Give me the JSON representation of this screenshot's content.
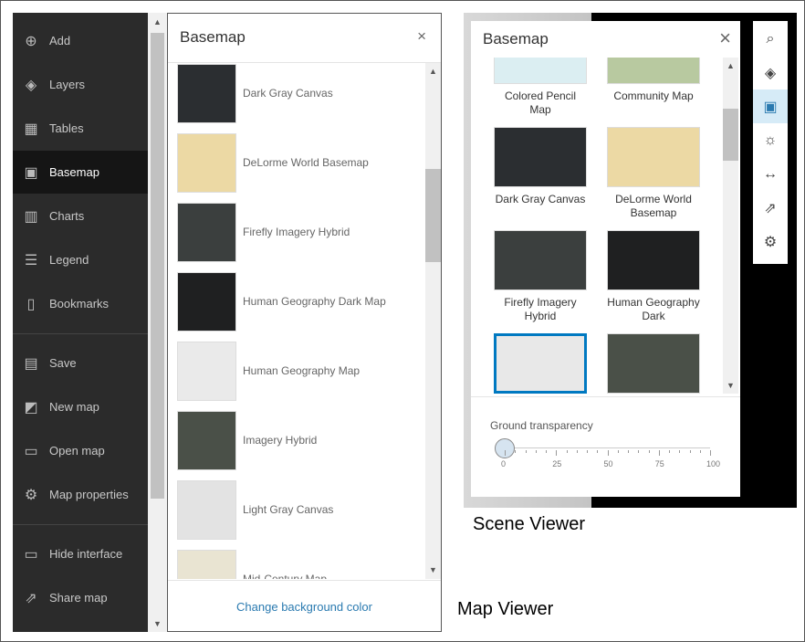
{
  "map_viewer": {
    "caption": "Map Viewer",
    "sidebar": [
      {
        "label": "Add",
        "icon": "plus-circle-icon",
        "glyph": "⊕"
      },
      {
        "label": "Layers",
        "icon": "layers-icon",
        "glyph": "◈"
      },
      {
        "label": "Tables",
        "icon": "table-icon",
        "glyph": "▦"
      },
      {
        "label": "Basemap",
        "icon": "basemap-icon",
        "glyph": "▣",
        "selected": true
      },
      {
        "label": "Charts",
        "icon": "chart-icon",
        "glyph": "▥"
      },
      {
        "label": "Legend",
        "icon": "legend-icon",
        "glyph": "☰"
      },
      {
        "label": "Bookmarks",
        "icon": "bookmark-icon",
        "glyph": "▯"
      },
      {
        "label": "Save",
        "icon": "save-icon",
        "glyph": "▤"
      },
      {
        "label": "New map",
        "icon": "new-map-icon",
        "glyph": "◩"
      },
      {
        "label": "Open map",
        "icon": "folder-icon",
        "glyph": "▭"
      },
      {
        "label": "Map properties",
        "icon": "gear-icon",
        "glyph": "⚙"
      },
      {
        "label": "Hide interface",
        "icon": "monitor-icon",
        "glyph": "▭"
      },
      {
        "label": "Share map",
        "icon": "share-icon",
        "glyph": "⇗"
      }
    ],
    "panel": {
      "title": "Basemap",
      "close": "×",
      "footer": "Change background color",
      "items": [
        {
          "label": "Dark Gray Canvas",
          "color": "#2b2e31"
        },
        {
          "label": "DeLorme World Basemap",
          "color": "#ecd9a4"
        },
        {
          "label": "Firefly Imagery Hybrid",
          "color": "#3b3f3e"
        },
        {
          "label": "Human Geography Dark Map",
          "color": "#1f2021"
        },
        {
          "label": "Human Geography Map",
          "color": "#eaeaea"
        },
        {
          "label": "Imagery Hybrid",
          "color": "#4a5048"
        },
        {
          "label": "Light Gray Canvas",
          "color": "#e3e3e3"
        },
        {
          "label": "Mid-Century Map",
          "color": "#e9e4d2"
        }
      ]
    }
  },
  "scene_viewer": {
    "caption": "Scene Viewer",
    "panel": {
      "title": "Basemap",
      "close": "×",
      "items": [
        {
          "label": "Colored Pencil Map",
          "color": "#dbeef2"
        },
        {
          "label": "Community Map",
          "color": "#b8c9a0"
        },
        {
          "label": "Dark Gray Canvas",
          "color": "#2b2e31"
        },
        {
          "label": "DeLorme World Basemap",
          "color": "#ecd9a4"
        },
        {
          "label": "Firefly Imagery Hybrid",
          "color": "#3b3f3e"
        },
        {
          "label": "Human Geography Dark",
          "color": "#1f2021"
        },
        {
          "label": "",
          "color": "#e8e8e8",
          "selected": true
        },
        {
          "label": "",
          "color": "#4a5048"
        }
      ]
    },
    "slider": {
      "label": "Ground transparency",
      "value": 0,
      "ticks": [
        "0",
        "25",
        "50",
        "75",
        "100"
      ]
    },
    "toolbar": [
      {
        "icon": "search-icon",
        "glyph": "⌕"
      },
      {
        "icon": "layers-icon",
        "glyph": "◈"
      },
      {
        "icon": "basemap-icon",
        "glyph": "▣",
        "selected": true
      },
      {
        "icon": "daylight-icon",
        "glyph": "☼"
      },
      {
        "icon": "measure-icon",
        "glyph": "↔"
      },
      {
        "icon": "share-icon",
        "glyph": "⇗"
      },
      {
        "icon": "settings-icon",
        "glyph": "⚙"
      }
    ],
    "accent": "#0079c1"
  }
}
